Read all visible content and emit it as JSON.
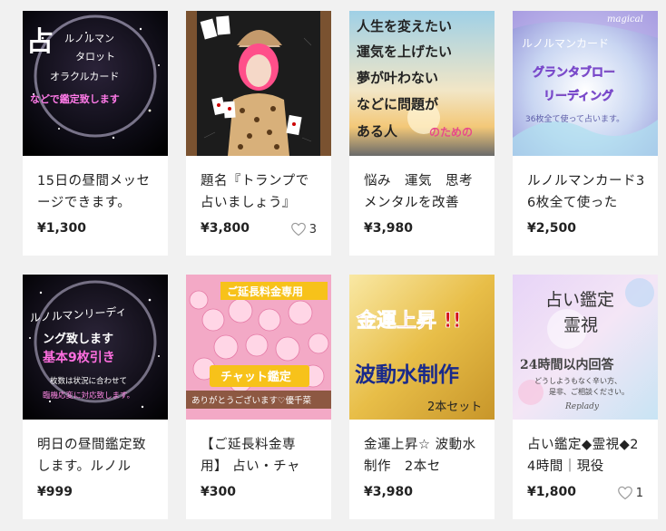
{
  "items": [
    {
      "title": "15日の昼間メッセージできます。",
      "price": "¥1,300",
      "likes": "",
      "thumb_text": [
        "占",
        "ルノルマン",
        "タロット",
        "オラクルカード",
        "などで鑑定致します"
      ]
    },
    {
      "title": "題名『トランプで占いましょう』",
      "price": "¥3,800",
      "likes": "3",
      "thumb_text": []
    },
    {
      "title": "悩み　運気　思考メンタルを改善",
      "price": "¥3,980",
      "likes": "",
      "thumb_text": [
        "人生を変えたい",
        "運気を上げたい",
        "夢が叶わない",
        "などに問題が",
        "ある人",
        "のための"
      ]
    },
    {
      "title": "ルノルマンカード36枚全て使った",
      "price": "¥2,500",
      "likes": "",
      "thumb_text": [
        "magical",
        "ルノルマンカード",
        "グランタブロー",
        "リーディング",
        "36枚全て使って占います。"
      ]
    },
    {
      "title": "明日の昼間鑑定致します。ルノル",
      "price": "¥999",
      "likes": "",
      "thumb_text": [
        "ルノルマンリーディ",
        "ング致します",
        "基本9枚引き",
        "枚数は状況に合わせて",
        "臨機応変に対応致します。"
      ]
    },
    {
      "title": "【ご延長料金専用】 占い・チャ",
      "price": "¥300",
      "likes": "",
      "thumb_text": [
        "ご延長料金専用",
        "チャット鑑定",
        "ありがとうございます♡優千菜"
      ]
    },
    {
      "title": "金運上昇☆ 波動水制作　2本セ",
      "price": "¥3,980",
      "likes": "",
      "thumb_text": [
        "金運上昇 !!",
        "波動水制作",
        "2本セット"
      ]
    },
    {
      "title": "占い鑑定◆霊視◆24時間｜現役",
      "price": "¥1,800",
      "likes": "1",
      "thumb_text": [
        "占い鑑定",
        "霊視",
        "24時間以内回答",
        "どうしようもなく辛い方、",
        "是非、ご相談ください。",
        "Replady"
      ]
    }
  ],
  "colors": {
    "card_bg": "#ffffff",
    "page_bg": "#f1f1f1",
    "text": "#222222",
    "heart": "#999999"
  },
  "icons": {
    "like": "heart-outline-icon"
  }
}
